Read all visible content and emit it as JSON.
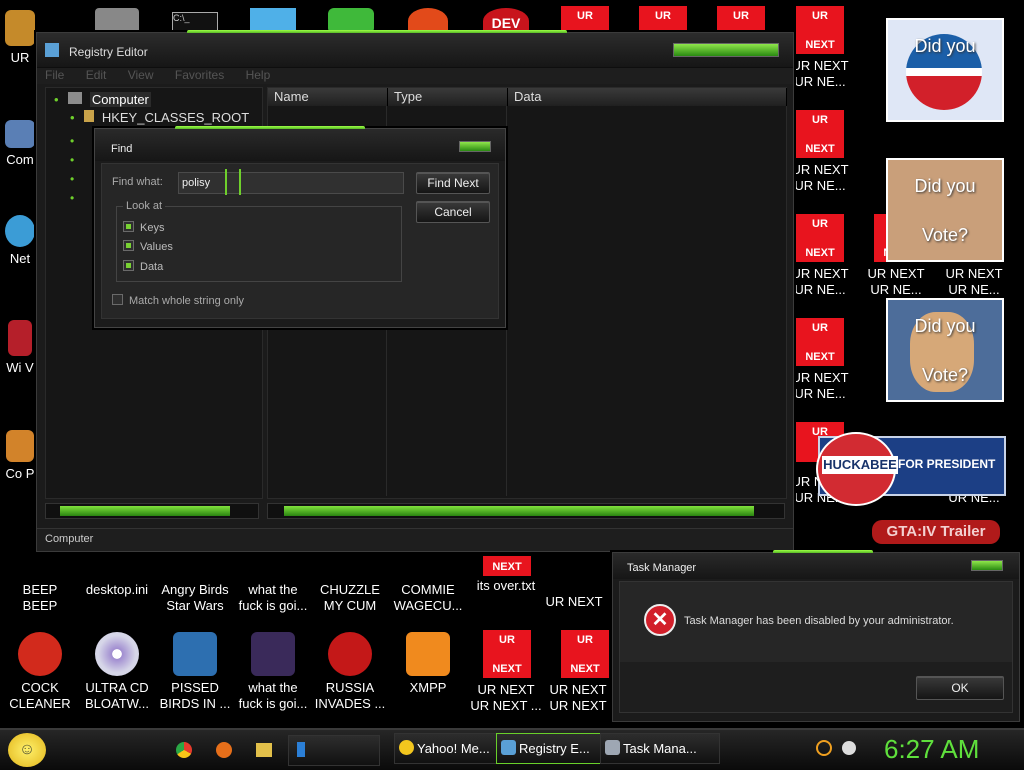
{
  "desktop": {
    "left_icons": [
      "UR",
      "Com",
      "Net",
      "Wi V",
      "Co P"
    ],
    "row1": [
      {
        "line1": "BEEP",
        "line2": "BEEP"
      },
      {
        "line1": "desktop.ini",
        "line2": ""
      },
      {
        "line1": "Angry Birds",
        "line2": "Star Wars"
      },
      {
        "line1": "what the",
        "line2": "fuck is goi..."
      },
      {
        "line1": "CHUZZLE",
        "line2": "MY CUM"
      },
      {
        "line1": "COMMIE",
        "line2": "WAGECU..."
      },
      {
        "line1": "its over.txt",
        "line2": ""
      },
      {
        "line1": "UR NEXT",
        "line2": ""
      }
    ],
    "row2": [
      {
        "line1": "COCK",
        "line2": "CLEANER"
      },
      {
        "line1": "ULTRA CD",
        "line2": "BLOATW..."
      },
      {
        "line1": "PISSED",
        "line2": "BIRDS IN ..."
      },
      {
        "line1": "what the",
        "line2": "fuck is goi..."
      },
      {
        "line1": "RUSSIA",
        "line2": "INVADES ..."
      },
      {
        "line1": "XMPP",
        "line2": ""
      },
      {
        "line1": "UR NEXT",
        "line2": "UR NEXT ..."
      },
      {
        "line1": "UR NEXT",
        "line2": "UR NEXT"
      }
    ],
    "tile_top": "UR",
    "tile_bottom": "NEXT",
    "tile_label1": "UR NEXT",
    "tile_label2": "UR NE...",
    "popups": {
      "did_you": "Did you",
      "vote": "Vote?"
    },
    "huckabee": {
      "name": "HUCKABEE",
      "tagline": "FOR PRESIDENT"
    },
    "gta_label": "GTA:IV Trailer"
  },
  "registry": {
    "title": "Registry Editor",
    "menu": [
      "File",
      "Edit",
      "View",
      "Favorites",
      "Help"
    ],
    "tree_root": "Computer",
    "tree_first": "HKEY_CLASSES_ROOT",
    "columns": [
      "Name",
      "Type",
      "Data"
    ],
    "status": "Computer"
  },
  "find": {
    "title": "Find",
    "find_what_label": "Find what:",
    "find_value": "polisy",
    "find_next": "Find Next",
    "cancel": "Cancel",
    "look_at": "Look at",
    "keys": "Keys",
    "values": "Values",
    "data": "Data",
    "match_whole": "Match whole string only"
  },
  "task_manager": {
    "title": "Task Manager",
    "message": "Task Manager has been disabled by your administrator.",
    "ok": "OK"
  },
  "taskbar": {
    "buttons": [
      "Yahoo! Me...",
      "Registry E...",
      "Task Mana..."
    ],
    "clock": "6:27 AM"
  },
  "colors": {
    "accent_green": "#6fd02c",
    "tile_red": "#e8141e",
    "error_red": "#d21f2a"
  }
}
